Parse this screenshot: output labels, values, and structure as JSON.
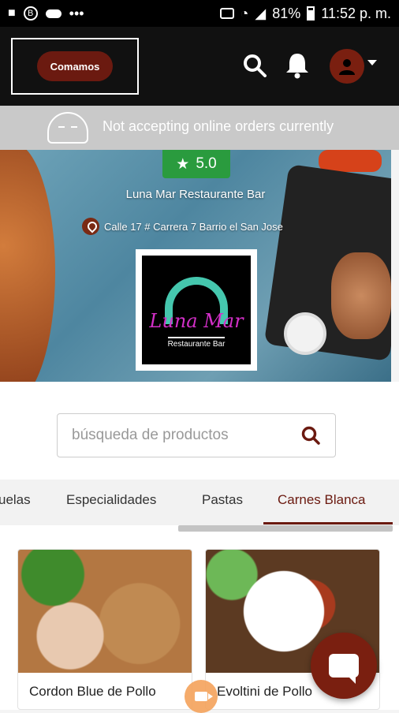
{
  "status_bar": {
    "battery": "81%",
    "time": "11:52 p. m.",
    "left_icons": [
      "video-icon",
      "b-icon",
      "cloud-icon",
      "more-icon"
    ],
    "right_icons": [
      "cast-icon",
      "wifi-icon",
      "signal-icon",
      "battery-icon"
    ]
  },
  "header": {
    "logo_text": "Comamos",
    "icons": [
      "search-icon",
      "bell-icon",
      "user-icon",
      "caret-down-icon"
    ]
  },
  "notice": {
    "text": "Not accepting online orders currently",
    "icon": "sleeping-face-icon"
  },
  "restaurant": {
    "rating": "5.0",
    "name": "Luna Mar Restaurante Bar",
    "address": "Calle 17 # Carrera 7 Barrio el San Jose",
    "logo_name": "Luna Mar",
    "logo_subtitle": "Restaurante Bar"
  },
  "search": {
    "placeholder": "búsqueda de productos"
  },
  "tabs": [
    {
      "label": "uelas"
    },
    {
      "label": "Especialidades"
    },
    {
      "label": "Pastas"
    },
    {
      "label": "Carnes Blanca"
    }
  ],
  "products": [
    {
      "title": "Cordon Blue de Pollo"
    },
    {
      "title": "Evoltini de Pollo"
    }
  ],
  "colors": {
    "brand": "#7a1f10",
    "rating_green": "#2a9b3e",
    "notice_gray": "#c9c9c9"
  }
}
